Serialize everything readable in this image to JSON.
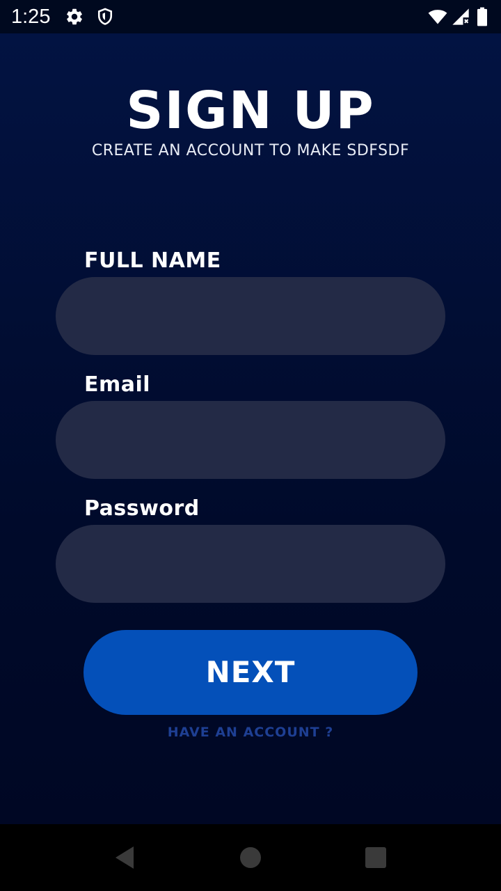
{
  "status_bar": {
    "time": "1:25",
    "icons": [
      "gear-icon",
      "shield-icon",
      "wifi-icon",
      "signal-icon",
      "battery-icon"
    ]
  },
  "header": {
    "title": "SIGN UP",
    "subtitle": "CREATE AN ACCOUNT TO MAKE SDFSDF"
  },
  "form": {
    "full_name": {
      "label": "FULL NAME",
      "value": ""
    },
    "email": {
      "label": "Email",
      "value": ""
    },
    "password": {
      "label": "Password",
      "value": ""
    }
  },
  "actions": {
    "next_label": "NEXT",
    "have_account_label": "HAVE AN ACCOUNT ?"
  },
  "colors": {
    "background_top": "#021342",
    "background_bottom": "#000724",
    "input_fill": "#232a46",
    "button_fill": "#0450b9",
    "link_text": "#1e3f93"
  },
  "nav_bar": {
    "icons": [
      "back-icon",
      "home-icon",
      "recents-icon"
    ]
  }
}
